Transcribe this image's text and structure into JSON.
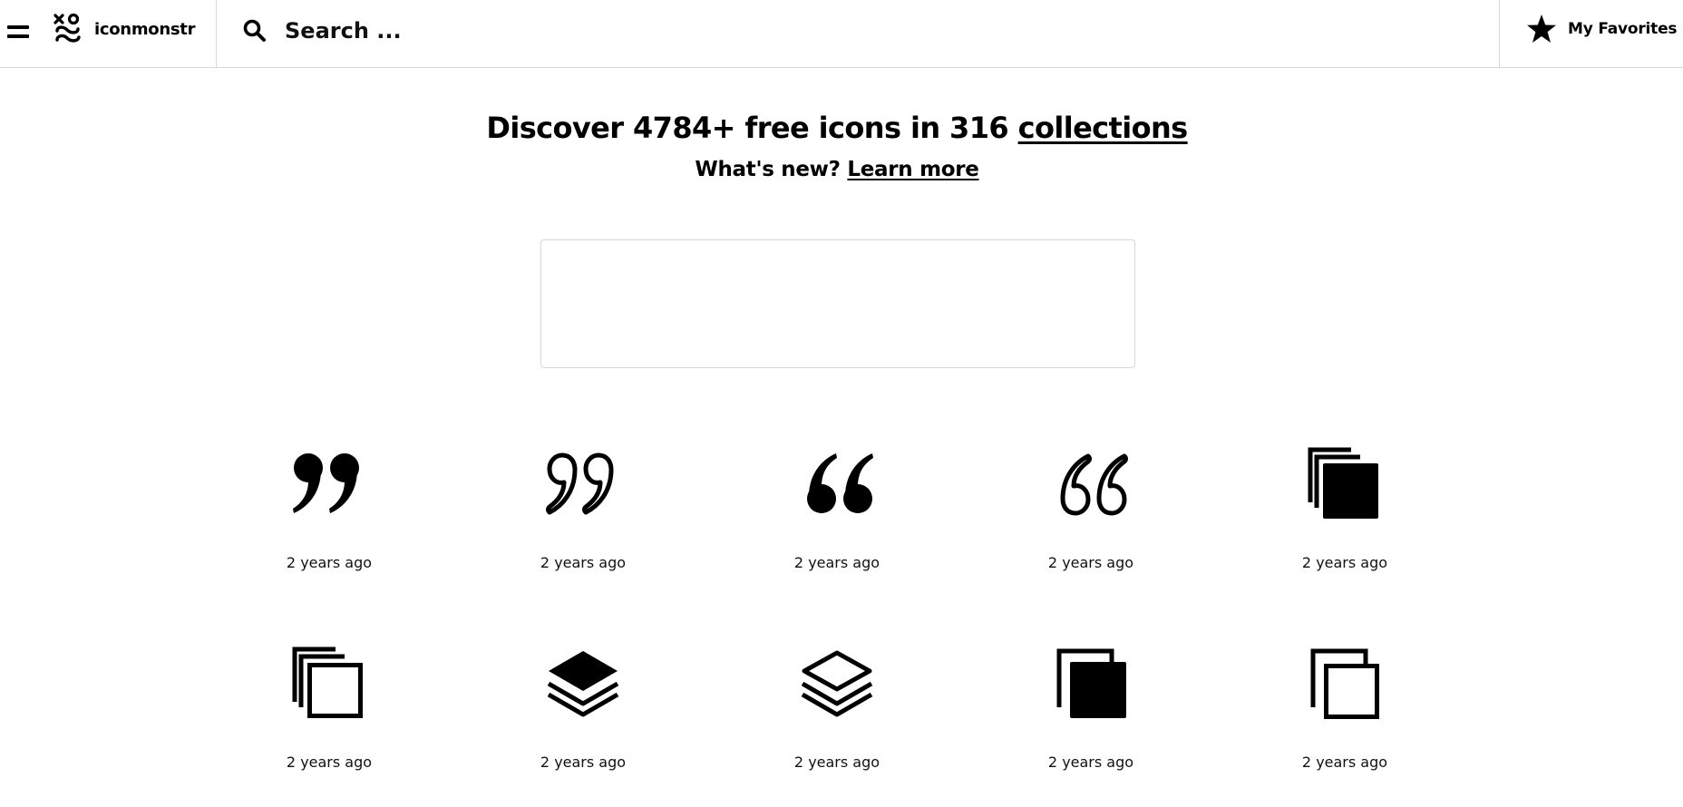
{
  "header": {
    "logo_text": "iconmonstr",
    "search_placeholder": "Search ...",
    "favorites_label": "My Favorites"
  },
  "hero": {
    "title_prefix": "Discover 4784+ free icons in 316 ",
    "title_link": "collections",
    "sub_prefix": "What's new? ",
    "sub_link": "Learn more"
  },
  "icons": [
    {
      "name": "quote-filled-closing-icon",
      "ago": "2 years ago"
    },
    {
      "name": "quote-outline-closing-icon",
      "ago": "2 years ago"
    },
    {
      "name": "quote-filled-opening-icon",
      "ago": "2 years ago"
    },
    {
      "name": "quote-outline-opening-icon",
      "ago": "2 years ago"
    },
    {
      "name": "layers-stacked-filled-icon",
      "ago": "2 years ago"
    },
    {
      "name": "layers-stacked-outline-icon",
      "ago": "2 years ago"
    },
    {
      "name": "stack-layers-filled-icon",
      "ago": "2 years ago"
    },
    {
      "name": "stack-layers-outline-icon",
      "ago": "2 years ago"
    },
    {
      "name": "copy-filled-icon",
      "ago": "2 years ago"
    },
    {
      "name": "copy-outline-icon",
      "ago": "2 years ago"
    }
  ]
}
